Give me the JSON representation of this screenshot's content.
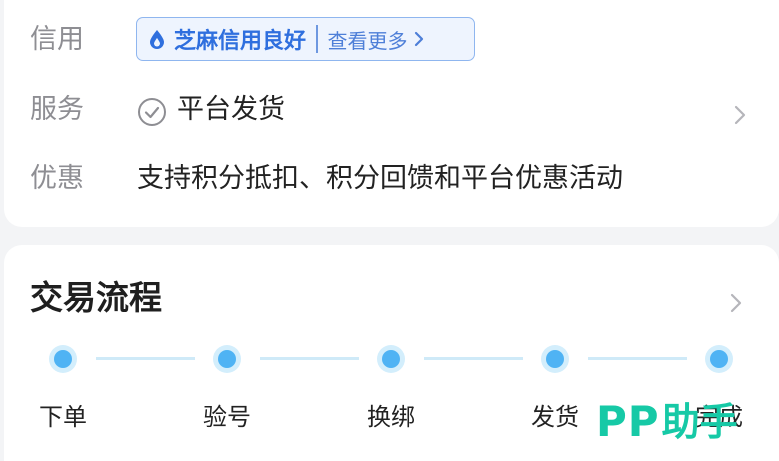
{
  "info": {
    "credit_label": "信用",
    "credit_badge": "芝麻信用良好",
    "credit_more": "查看更多",
    "service_label": "服务",
    "service_value": "平台发货",
    "benefit_label": "优惠",
    "benefit_value": "支持积分抵扣、积分回馈和平台优惠活动"
  },
  "process": {
    "title": "交易流程",
    "steps": [
      {
        "label": "下单"
      },
      {
        "label": "验号"
      },
      {
        "label": "换绑"
      },
      {
        "label": "发货"
      },
      {
        "label": "完成"
      }
    ]
  },
  "watermark": {
    "brand": "PP",
    "suffix": "助手"
  },
  "colors": {
    "accent_blue": "#2f6fde",
    "step_blue": "#4fb3f4",
    "watermark_green": "#16c9a6"
  },
  "icons": {
    "credit": "flame-drop-icon",
    "service": "check-circle-icon",
    "chevron": "chevron-right-icon"
  }
}
